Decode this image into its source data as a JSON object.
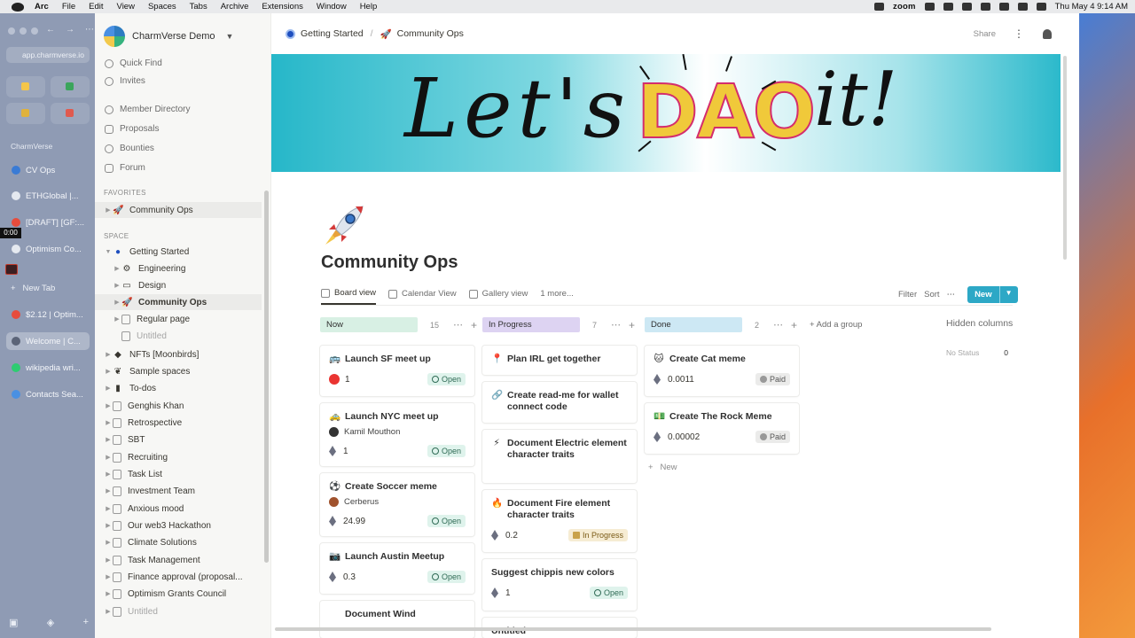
{
  "menubar": {
    "app": "Arc",
    "items": [
      "File",
      "Edit",
      "View",
      "Spaces",
      "Tabs",
      "Archive",
      "Extensions",
      "Window",
      "Help"
    ],
    "zoom": "zoom",
    "clock": "Thu May 4  9:14 AM"
  },
  "arc": {
    "url": "app.charmverse.io",
    "space_label": "CharmVerse",
    "tabs": [
      "CV Ops",
      "ETHGlobal |...",
      "[DRAFT] [GF:...",
      "Optimism Co..."
    ],
    "timer": "0:00",
    "new_tab": "New Tab",
    "tabs2": [
      "$2.12 | Optim...",
      "Welcome | C...",
      "wikipedia wri...",
      "Contacts Sea..."
    ]
  },
  "sidebar": {
    "workspace": "CharmVerse Demo",
    "quick_find": "Quick Find",
    "invites": "Invites",
    "nav": [
      "Member Directory",
      "Proposals",
      "Bounties",
      "Forum"
    ],
    "favorites_label": "FAVORITES",
    "favorite": "Community Ops",
    "space_label": "SPACE",
    "pages": [
      "Getting Started",
      "Engineering",
      "Design",
      "Community Ops",
      "Regular page",
      "Untitled",
      "NFTs [Moonbirds]",
      "Sample spaces",
      "To-dos",
      "Genghis Khan",
      "Retrospective",
      "SBT",
      "Recruiting",
      "Task List",
      "Investment Team",
      "Anxious mood",
      "Our web3 Hackathon",
      "Climate Solutions",
      "Task Management",
      "Finance approval (proposal...",
      "Optimism Grants Council",
      "Untitled"
    ]
  },
  "topbar": {
    "crumb1": "Getting Started",
    "crumb2": "Community Ops",
    "share": "Share"
  },
  "banner": {
    "w1": "Let's",
    "w2": "DAO",
    "w3": "it!"
  },
  "page": {
    "title": "Community Ops",
    "views": [
      "Board view",
      "Calendar View",
      "Gallery view",
      "1 more..."
    ],
    "filter": "Filter",
    "sort": "Sort",
    "new": "New",
    "add_group": "+ Add a group",
    "hidden_columns": "Hidden columns",
    "no_status": "No Status",
    "no_status_count": "0",
    "new_card": "New"
  },
  "columns": [
    {
      "name": "Now",
      "count": "15",
      "color": "#d8f0e4"
    },
    {
      "name": "In Progress",
      "count": "7",
      "color": "#ddd3f2"
    },
    {
      "name": "Done",
      "count": "2",
      "color": "#cde8f4"
    }
  ],
  "cards": {
    "now": [
      {
        "title": "Launch SF meet up",
        "value": "1",
        "status": "Open"
      },
      {
        "title": "Launch NYC meet up",
        "assignee": "Kamil Mouthon",
        "value": "1",
        "status": "Open"
      },
      {
        "title": "Create Soccer meme",
        "assignee": "Cerberus",
        "value": "24.99",
        "status": "Open"
      },
      {
        "title": "Launch Austin Meetup",
        "value": "0.3",
        "status": "Open"
      },
      {
        "title": "Document Wind"
      }
    ],
    "progress": [
      {
        "title": "Plan IRL get together"
      },
      {
        "title": "Create read-me for wallet connect code"
      },
      {
        "title": "Document Electric element character traits"
      },
      {
        "title": "Document Fire element character traits",
        "value": "0.2",
        "status": "In Progress"
      },
      {
        "title": "Suggest chippis new colors",
        "value": "1",
        "status": "Open"
      },
      {
        "title": "Untitled"
      }
    ],
    "done": [
      {
        "title": "Create Cat meme",
        "value": "0.0011",
        "status": "Paid"
      },
      {
        "title": "Create The Rock Meme",
        "value": "0.00002",
        "status": "Paid"
      }
    ]
  }
}
